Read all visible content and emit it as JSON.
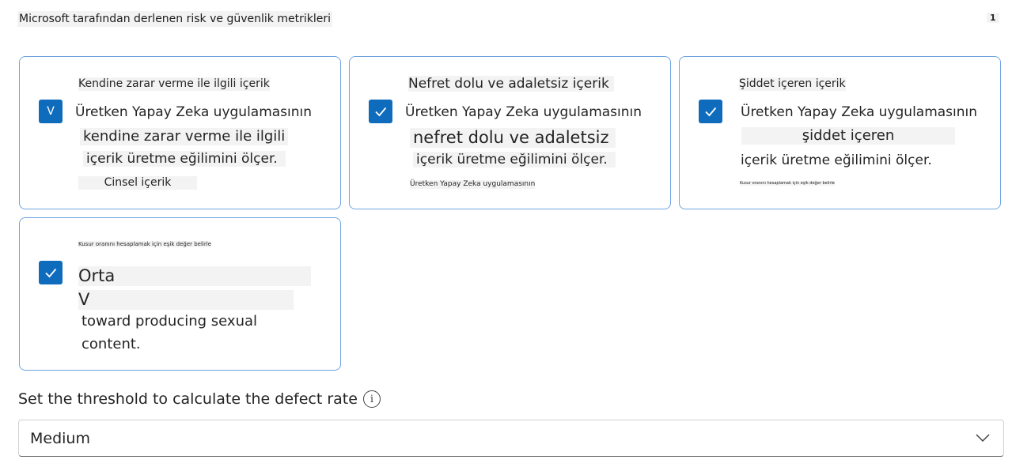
{
  "header": {
    "title": "Microsoft tarafından derlenen risk ve güvenlik metrikleri",
    "page_badge": "1"
  },
  "cards": [
    {
      "checked": true,
      "checkbox_glyph": "V",
      "title": "Kendine zarar verme ile ilgili içerik",
      "line1": "Üretken Yapay Zeka uygulamasının",
      "line2": "kendine zarar verme ile ilgili",
      "line3": "içerik üretme eğilimini ölçer.",
      "line4": "Cinsel içerik"
    },
    {
      "checked": true,
      "title": "Nefret dolu ve adaletsiz içerik",
      "line1": "Üretken Yapay Zeka uygulamasının",
      "line2": "nefret dolu ve adaletsiz",
      "line3": "içerik üretme eğilimini ölçer.",
      "line4": "Üretken Yapay Zeka uygulamasının"
    },
    {
      "checked": true,
      "title": "Şiddet içeren içerik",
      "line1": "Üretken Yapay Zeka uygulamasının",
      "line2": "şiddet içeren",
      "line3": "içerik üretme eğilimini ölçer.",
      "line4": "Kusur oranını hesaplamak için eşik değer belirle"
    },
    {
      "checked": true,
      "title": "Kusur oranını hesaplamak için eşik değer belirle",
      "line1": "Orta",
      "line2": "V",
      "line3": "toward producing sexual",
      "line4": "content."
    }
  ],
  "threshold": {
    "label": "Set the threshold to calculate the defect rate",
    "info_icon": "info-icon"
  },
  "dropdown": {
    "value": "Medium",
    "icon": "chevron-down-icon"
  }
}
